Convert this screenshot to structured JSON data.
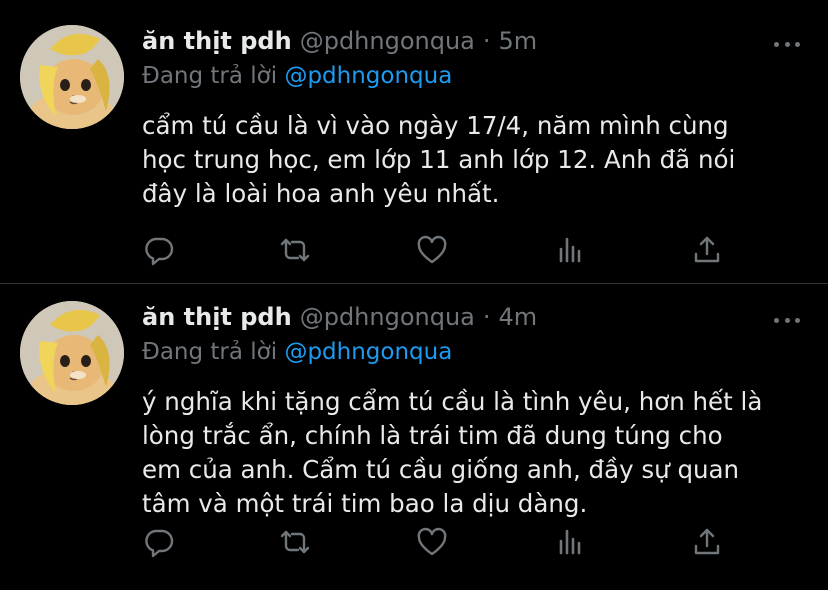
{
  "colors": {
    "background": "#000000",
    "text": "#e7e9ea",
    "secondary": "#71767b",
    "accent": "#1d9bf0",
    "divider": "#2f3336"
  },
  "tweets": [
    {
      "display_name": "ăn thịt pdh",
      "handle": "@pdhngonqua",
      "separator": "·",
      "time": "5m",
      "replying_prefix": "Đang trả lời",
      "replying_to": "@pdhngonqua",
      "text_lines": [
        "cẩm tú cầu là vì vào ngày 17/4, năm mình cùng",
        "học trung học, em lớp 11 anh lớp 12. Anh đã nói",
        "đây là loài hoa anh yêu nhất."
      ],
      "avatar_icon": "cat-with-banana-peel-avatar",
      "action_icons": [
        "reply-icon",
        "retweet-icon",
        "like-icon",
        "analytics-icon",
        "share-icon"
      ]
    },
    {
      "display_name": "ăn thịt pdh",
      "handle": "@pdhngonqua",
      "separator": "·",
      "time": "4m",
      "replying_prefix": "Đang trả lời",
      "replying_to": "@pdhngonqua",
      "text_lines": [
        "ý nghĩa khi tặng cẩm tú cầu là tình yêu, hơn hết là",
        "lòng trắc ẩn, chính là trái tim đã dung túng cho",
        "em của anh. Cẩm tú cầu giống anh, đầy sự quan",
        "tâm và một trái tim bao la dịu dàng."
      ],
      "avatar_icon": "cat-with-banana-peel-avatar",
      "action_icons": [
        "reply-icon",
        "retweet-icon",
        "like-icon",
        "analytics-icon",
        "share-icon"
      ]
    }
  ]
}
